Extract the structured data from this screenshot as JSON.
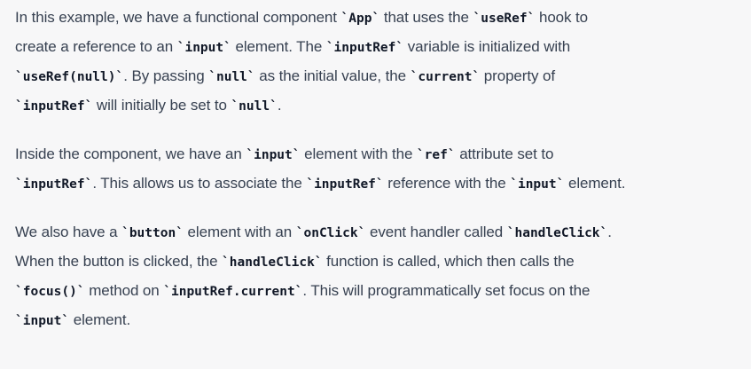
{
  "paragraphs": [
    {
      "lines": [
        [
          {
            "t": "text",
            "v": "In this example, we have a functional component "
          },
          {
            "t": "code",
            "v": "`App`"
          },
          {
            "t": "text",
            "v": " that uses the "
          },
          {
            "t": "code",
            "v": "`useRef`"
          },
          {
            "t": "text",
            "v": " hook to"
          }
        ],
        [
          {
            "t": "text",
            "v": "create a reference to an "
          },
          {
            "t": "code",
            "v": "`input`"
          },
          {
            "t": "text",
            "v": " element. The "
          },
          {
            "t": "code",
            "v": "`inputRef`"
          },
          {
            "t": "text",
            "v": " variable is initialized with"
          }
        ],
        [
          {
            "t": "code",
            "v": "`useRef(null)`"
          },
          {
            "t": "text",
            "v": ". By passing "
          },
          {
            "t": "code",
            "v": "`null`"
          },
          {
            "t": "text",
            "v": " as the initial value, the "
          },
          {
            "t": "code",
            "v": "`current`"
          },
          {
            "t": "text",
            "v": " property of"
          }
        ],
        [
          {
            "t": "code",
            "v": "`inputRef`"
          },
          {
            "t": "text",
            "v": " will initially be set to "
          },
          {
            "t": "code",
            "v": "`null`"
          },
          {
            "t": "text",
            "v": "."
          }
        ]
      ]
    },
    {
      "lines": [
        [
          {
            "t": "text",
            "v": "Inside the component, we have an "
          },
          {
            "t": "code",
            "v": "`input`"
          },
          {
            "t": "text",
            "v": " element with the "
          },
          {
            "t": "code",
            "v": "`ref`"
          },
          {
            "t": "text",
            "v": " attribute set to"
          }
        ],
        [
          {
            "t": "code",
            "v": "`inputRef`"
          },
          {
            "t": "text",
            "v": ". This allows us to associate the "
          },
          {
            "t": "code",
            "v": "`inputRef`"
          },
          {
            "t": "text",
            "v": " reference with the "
          },
          {
            "t": "code",
            "v": "`input`"
          },
          {
            "t": "text",
            "v": " element."
          }
        ]
      ]
    },
    {
      "lines": [
        [
          {
            "t": "text",
            "v": "We also have a "
          },
          {
            "t": "code",
            "v": "`button`"
          },
          {
            "t": "text",
            "v": " element with an "
          },
          {
            "t": "code",
            "v": "`onClick`"
          },
          {
            "t": "text",
            "v": " event handler called "
          },
          {
            "t": "code",
            "v": "`handleClick`"
          },
          {
            "t": "text",
            "v": "."
          }
        ],
        [
          {
            "t": "text",
            "v": "When the button is clicked, the "
          },
          {
            "t": "code",
            "v": "`handleClick`"
          },
          {
            "t": "text",
            "v": " function is called, which then calls the"
          }
        ],
        [
          {
            "t": "code",
            "v": "`focus()`"
          },
          {
            "t": "text",
            "v": " method on "
          },
          {
            "t": "code",
            "v": "`inputRef.current`"
          },
          {
            "t": "text",
            "v": ". This will programmatically set focus on the"
          }
        ],
        [
          {
            "t": "code",
            "v": "`input`"
          },
          {
            "t": "text",
            "v": " element."
          }
        ]
      ]
    }
  ]
}
